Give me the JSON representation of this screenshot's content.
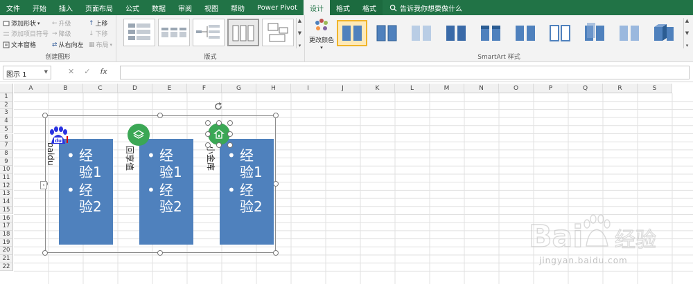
{
  "ribbon_tabs": {
    "file": "文件",
    "home": "开始",
    "insert": "插入",
    "layout": "页面布局",
    "formulas": "公式",
    "data": "数据",
    "review": "审阅",
    "view": "视图",
    "help": "帮助",
    "powerpivot": "Power Pivot",
    "design": "设计",
    "format1": "格式",
    "format2": "格式",
    "tellme": "告诉我你想要做什么"
  },
  "create_graphic": {
    "add_shape": "添加形状",
    "add_bullet": "添加项目符号",
    "text_pane": "文本窗格",
    "promote": "升级",
    "demote": "降级",
    "right_to_left": "从右向左",
    "move_up": "上移",
    "move_down": "下移",
    "layout": "布局",
    "label": "创建图形"
  },
  "layouts": {
    "label": "版式"
  },
  "styles": {
    "change_colors": "更改颜色",
    "label": "SmartArt 样式"
  },
  "formula_bar": {
    "name_box": "图示 1",
    "fx": "fx"
  },
  "columns": [
    "A",
    "B",
    "C",
    "D",
    "E",
    "F",
    "G",
    "H",
    "I",
    "J",
    "K",
    "L",
    "M",
    "N",
    "O",
    "P",
    "Q",
    "R",
    "S"
  ],
  "rows": [
    "1",
    "2",
    "3",
    "4",
    "5",
    "6",
    "7",
    "8",
    "9",
    "10",
    "11",
    "12",
    "13",
    "14",
    "15",
    "16",
    "17",
    "18",
    "19",
    "20",
    "21",
    "22"
  ],
  "smartart": {
    "items": [
      {
        "label": "baidu",
        "icon": "baidu-paw-icon",
        "bullets": [
          "经验1",
          "经验2"
        ]
      },
      {
        "label": "回享值",
        "icon": "layers-icon",
        "bullets": [
          "经验1",
          "经验2"
        ]
      },
      {
        "label": "小金库",
        "icon": "home-icon",
        "bullets": [
          "经验1",
          "经验2"
        ]
      }
    ],
    "fill_color": "#4f81bd",
    "icon_color": "#3ba755"
  },
  "watermark": {
    "url": "jingyan.baidu.com",
    "brand": "Baidu 经验"
  }
}
